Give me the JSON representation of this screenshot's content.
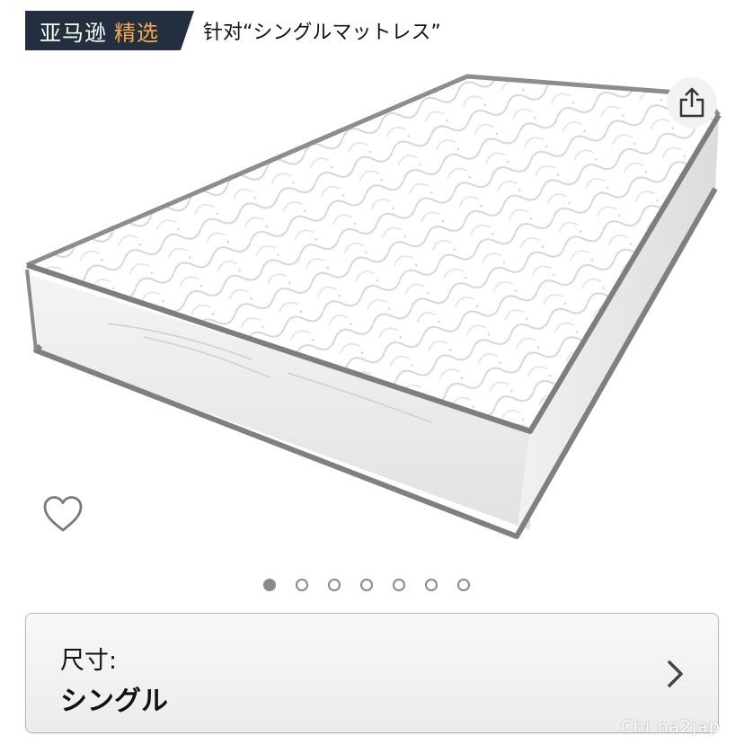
{
  "header": {
    "brand": "亚马逊",
    "choice": "精选",
    "context": "针对“シングルマットレス”"
  },
  "gallery": {
    "image_description": "mattress-product-photo",
    "dot_count": 7,
    "active_index": 0
  },
  "size_selector": {
    "label": "尺寸:",
    "value": "シングル"
  },
  "watermark": "Chi na2jap",
  "colors": {
    "badge_bg": "#232f3e",
    "badge_accent": "#f7a84b"
  }
}
